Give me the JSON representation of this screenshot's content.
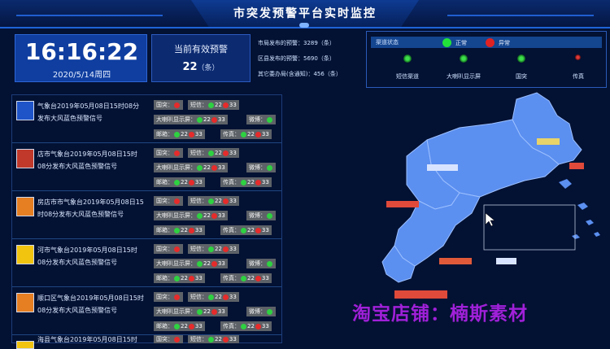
{
  "header": {
    "title": "市突发预警平台实时监控"
  },
  "clock": {
    "time": "16:16:22",
    "date": "2020/5/14周四"
  },
  "active": {
    "label": "当前有效预警",
    "count": "22",
    "unit": "（条）"
  },
  "stats": [
    "市局发布的预警：3289（条）",
    "区县发布的预警：5690（条）",
    "其它委办局(含通知)：456（条）"
  ],
  "channel_status": {
    "title": "渠道状态",
    "legend_normal": "正常",
    "legend_abnormal": "异常",
    "channels": [
      {
        "label": "短信渠道",
        "status": "normal"
      },
      {
        "label": "大喇叭显示屏",
        "status": "normal"
      },
      {
        "label": "国突",
        "status": "normal"
      },
      {
        "label": "传真",
        "status": "abnormal"
      }
    ]
  },
  "warnings": [
    {
      "title": "气象台2019年05月08日15时08分发布大风蓝色预警信号",
      "line1": "气象台2019年05月08日15时08分",
      "line2": "发布大风蓝色预警信号",
      "icon_color": "#1f54c9"
    },
    {
      "title": "店市气象台2019年05月08日15时08分发布大风蓝色预警信号",
      "line1": "店市气象台2019年05月08日15时",
      "line2": "08分发布大风蓝色预警信号",
      "icon_color": "#c0392b"
    },
    {
      "title": "房店市市气象台2019年05月08日15时08分发布大风蓝色预警信号",
      "line1": "房店市市气象台2019年05月08日15",
      "line2": "时08分发布大风蓝色预警信号",
      "icon_color": "#e67e22"
    },
    {
      "title": "河市气象台2019年05月08日15时08分发布大风蓝色预警信号",
      "line1": "河市气象台2019年05月08日15时",
      "line2": "08分发布大风蓝色预警信号",
      "icon_color": "#f1c40f"
    },
    {
      "title": "顺口区气象台2019年05月08日15时08分发布大风蓝色预警信号",
      "line1": "顺口区气象台2019年05月08日15时",
      "line2": "08分发布大风蓝色预警信号",
      "icon_color": "#e67e22"
    },
    {
      "title": "海县气象台2019年05月08日15时",
      "line1": "海县气象台2019年05月08日15时",
      "line2": "",
      "icon_color": "#f1c40f"
    }
  ],
  "chips": {
    "guotu": "国突：",
    "sms": "短信：",
    "speaker": "大喇叭显示屏：",
    "wechat": "微博：",
    "email": "邮箱：",
    "fax": "传真：",
    "n": "22",
    "m": "33"
  },
  "watermark": "淘宝店铺：楠斯素材",
  "colors": {
    "map_fill": "#5b8ff0",
    "accent": "#1e63d6",
    "ok": "#2ed141",
    "bad": "#e52b2b"
  }
}
